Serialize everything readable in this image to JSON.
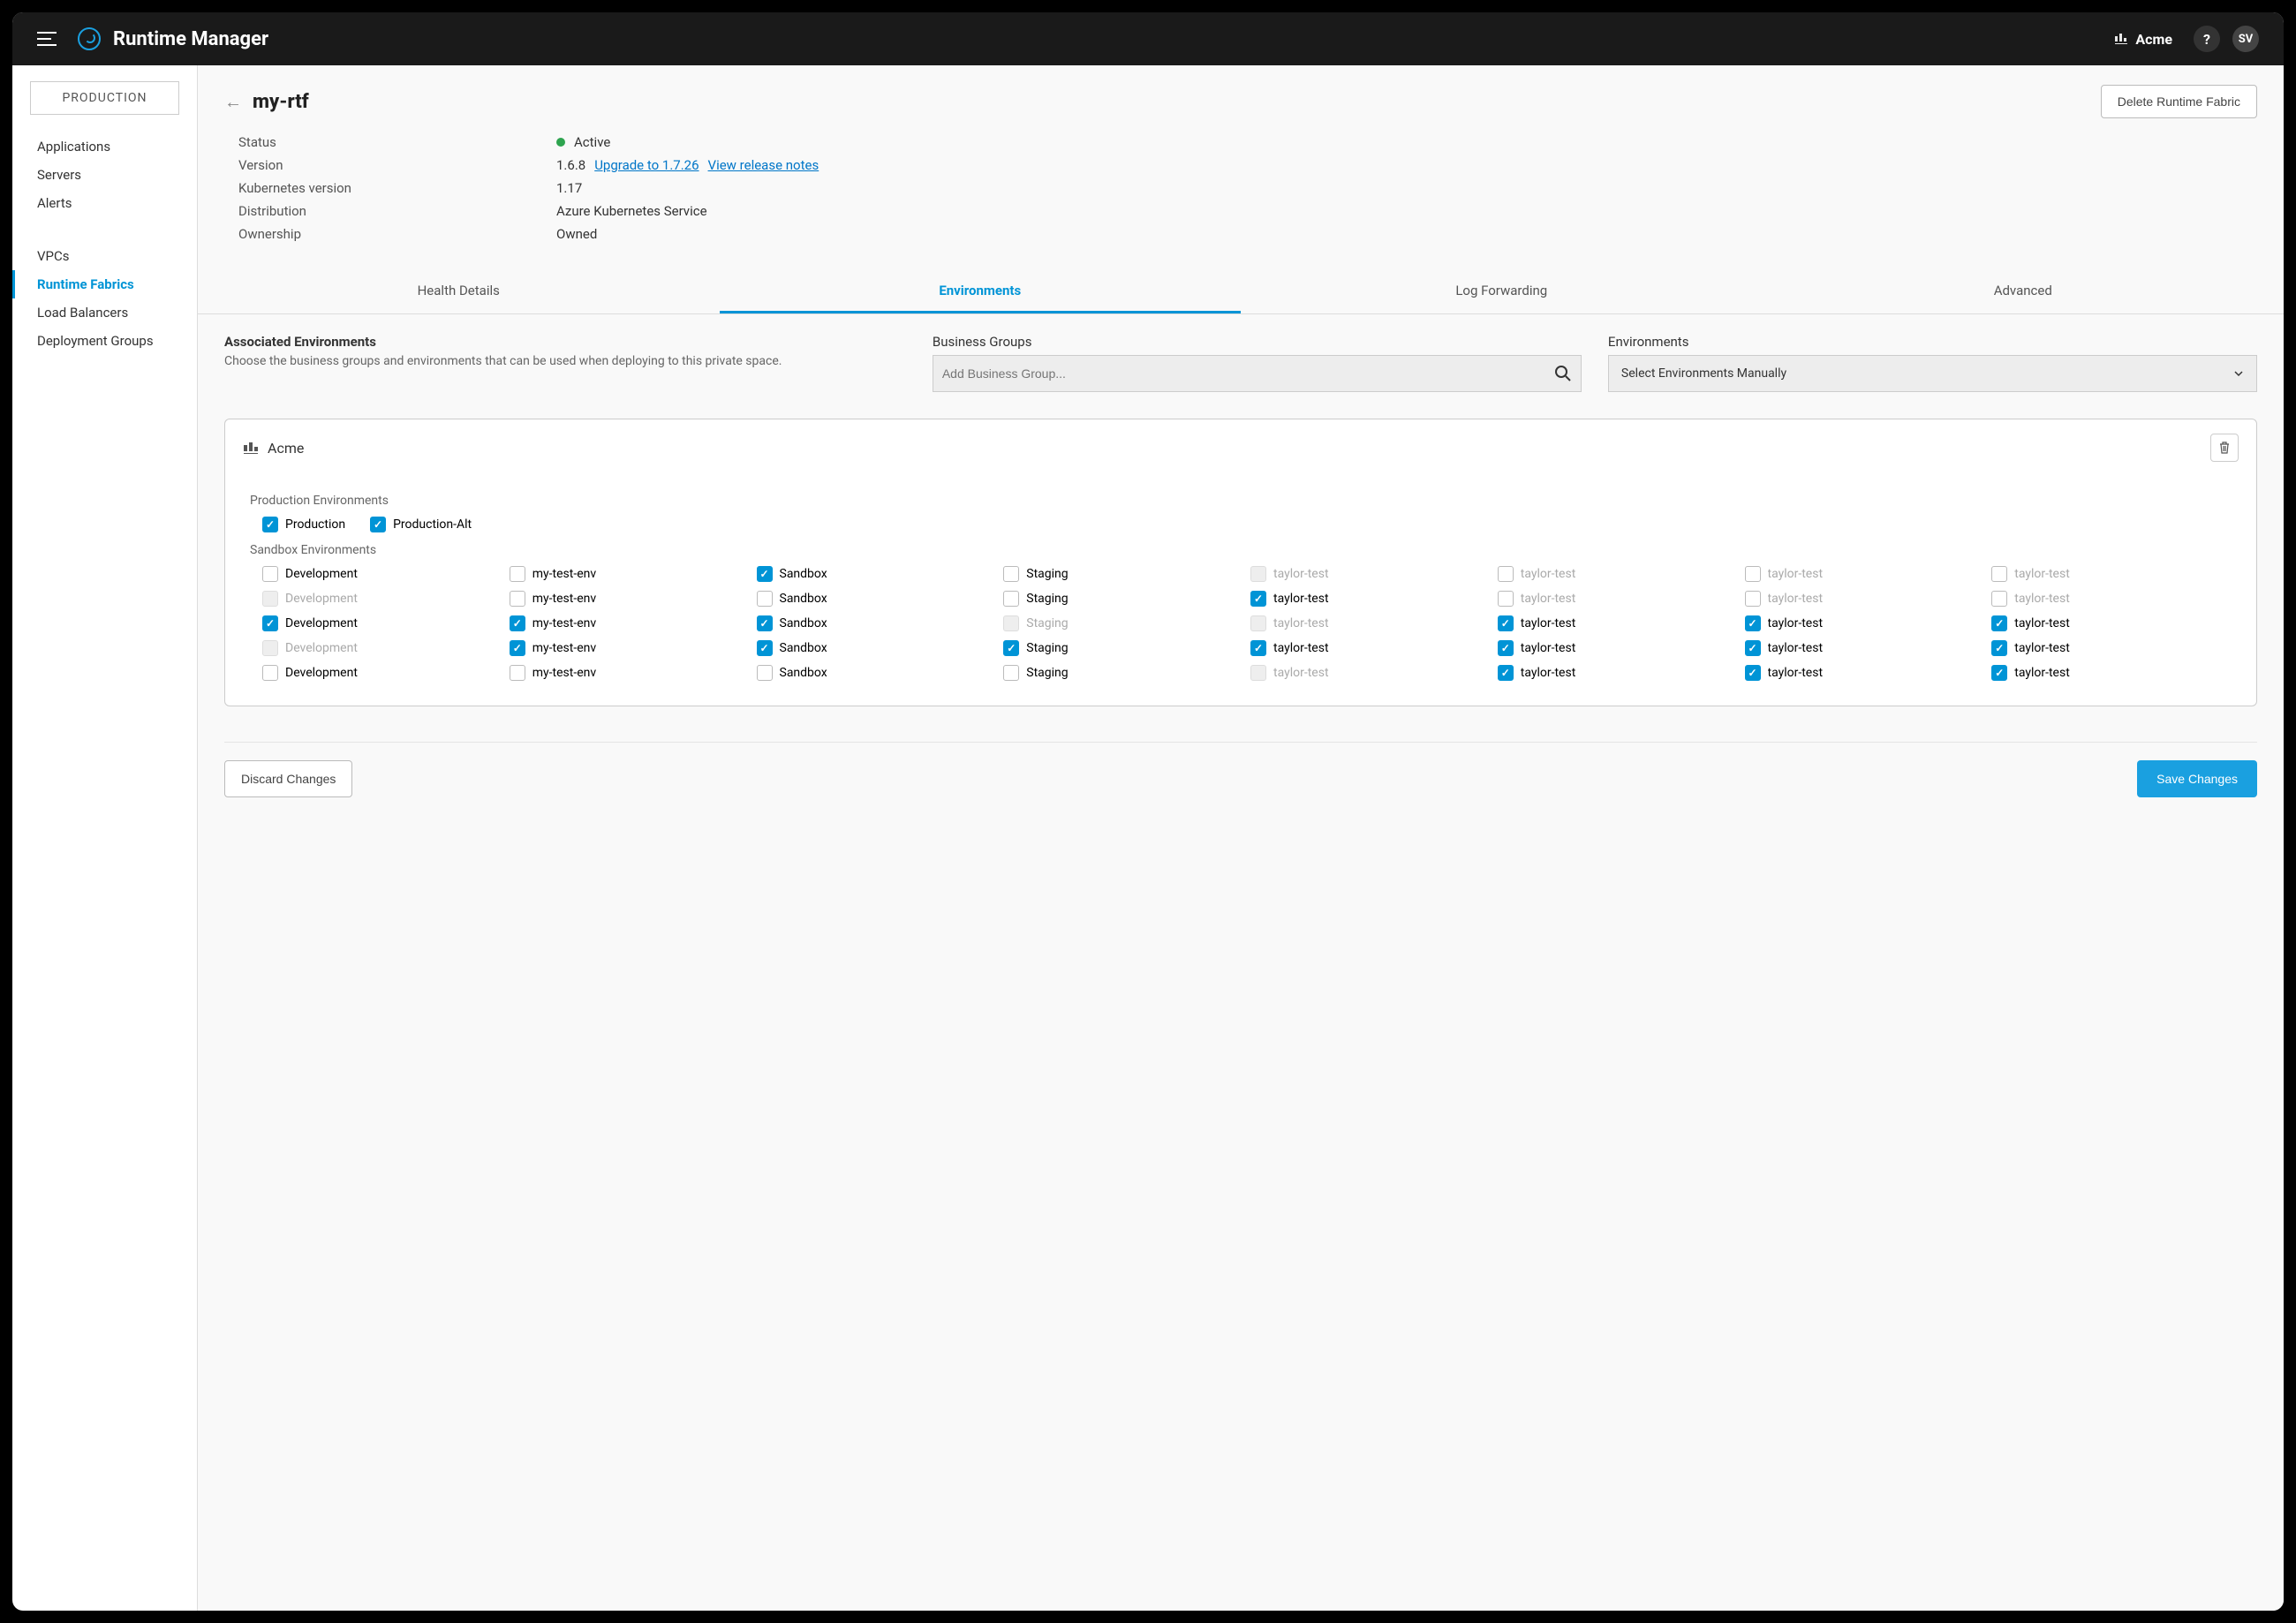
{
  "app": {
    "title": "Runtime Manager"
  },
  "topbar": {
    "org": "Acme",
    "help": "?",
    "user_initials": "SV"
  },
  "sidebar": {
    "env_chip": "PRODUCTION",
    "groups": [
      [
        "Applications",
        "Servers",
        "Alerts"
      ],
      [
        "VPCs",
        "Runtime Fabrics",
        "Load Balancers",
        "Deployment Groups"
      ]
    ],
    "active": "Runtime Fabrics"
  },
  "page": {
    "title": "my-rtf",
    "delete_button": "Delete Runtime Fabric",
    "details": {
      "status_label": "Status",
      "status_value": "Active",
      "version_label": "Version",
      "version_value": "1.6.8",
      "upgrade_link": "Upgrade to 1.7.26",
      "release_notes_link": "View release notes",
      "k8s_label": "Kubernetes version",
      "k8s_value": "1.17",
      "dist_label": "Distribution",
      "dist_value": "Azure Kubernetes Service",
      "owner_label": "Ownership",
      "owner_value": "Owned"
    },
    "tabs": [
      "Health Details",
      "Environments",
      "Log Forwarding",
      "Advanced"
    ],
    "active_tab": "Environments"
  },
  "assoc": {
    "title": "Associated Environments",
    "desc": "Choose the business groups and environments that can be used when deploying to this private space.",
    "bg_label": "Business Groups",
    "bg_placeholder": "Add Business Group...",
    "env_label": "Environments",
    "env_select_value": "Select Environments Manually"
  },
  "card": {
    "org": "Acme",
    "prod_label": "Production Environments",
    "prod_envs": [
      {
        "label": "Production",
        "checked": true,
        "dim": false
      },
      {
        "label": "Production-Alt",
        "checked": true,
        "dim": false
      }
    ],
    "sandbox_label": "Sandbox Environments",
    "sandbox_rows": [
      [
        {
          "label": "Development",
          "checked": false,
          "dim": false
        },
        {
          "label": "my-test-env",
          "checked": false,
          "dim": false
        },
        {
          "label": "Sandbox",
          "checked": true,
          "dim": false
        },
        {
          "label": "Staging",
          "checked": false,
          "dim": false
        },
        {
          "label": "taylor-test",
          "checked": false,
          "dim": true,
          "disabled": true
        },
        {
          "label": "taylor-test",
          "checked": false,
          "dim": true
        },
        {
          "label": "taylor-test",
          "checked": false,
          "dim": true
        },
        {
          "label": "taylor-test",
          "checked": false,
          "dim": true
        }
      ],
      [
        {
          "label": "Development",
          "checked": false,
          "dim": true,
          "disabled": true
        },
        {
          "label": "my-test-env",
          "checked": false,
          "dim": false
        },
        {
          "label": "Sandbox",
          "checked": false,
          "dim": false
        },
        {
          "label": "Staging",
          "checked": false,
          "dim": false
        },
        {
          "label": "taylor-test",
          "checked": true,
          "dim": false
        },
        {
          "label": "taylor-test",
          "checked": false,
          "dim": true
        },
        {
          "label": "taylor-test",
          "checked": false,
          "dim": true
        },
        {
          "label": "taylor-test",
          "checked": false,
          "dim": true
        }
      ],
      [
        {
          "label": "Development",
          "checked": true,
          "dim": false
        },
        {
          "label": "my-test-env",
          "checked": true,
          "dim": false
        },
        {
          "label": "Sandbox",
          "checked": true,
          "dim": false
        },
        {
          "label": "Staging",
          "checked": false,
          "dim": true,
          "disabled": true
        },
        {
          "label": "taylor-test",
          "checked": false,
          "dim": true,
          "disabled": true
        },
        {
          "label": "taylor-test",
          "checked": true,
          "dim": false
        },
        {
          "label": "taylor-test",
          "checked": true,
          "dim": false
        },
        {
          "label": "taylor-test",
          "checked": true,
          "dim": false
        }
      ],
      [
        {
          "label": "Development",
          "checked": false,
          "dim": true,
          "disabled": true
        },
        {
          "label": "my-test-env",
          "checked": true,
          "dim": false
        },
        {
          "label": "Sandbox",
          "checked": true,
          "dim": false
        },
        {
          "label": "Staging",
          "checked": true,
          "dim": false
        },
        {
          "label": "taylor-test",
          "checked": true,
          "dim": false
        },
        {
          "label": "taylor-test",
          "checked": true,
          "dim": false
        },
        {
          "label": "taylor-test",
          "checked": true,
          "dim": false
        },
        {
          "label": "taylor-test",
          "checked": true,
          "dim": false
        }
      ],
      [
        {
          "label": "Development",
          "checked": false,
          "dim": false
        },
        {
          "label": "my-test-env",
          "checked": false,
          "dim": false
        },
        {
          "label": "Sandbox",
          "checked": false,
          "dim": false
        },
        {
          "label": "Staging",
          "checked": false,
          "dim": false
        },
        {
          "label": "taylor-test",
          "checked": false,
          "dim": true,
          "disabled": true
        },
        {
          "label": "taylor-test",
          "checked": true,
          "dim": false
        },
        {
          "label": "taylor-test",
          "checked": true,
          "dim": false
        },
        {
          "label": "taylor-test",
          "checked": true,
          "dim": false
        }
      ]
    ]
  },
  "footer": {
    "discard": "Discard Changes",
    "save": "Save Changes"
  }
}
